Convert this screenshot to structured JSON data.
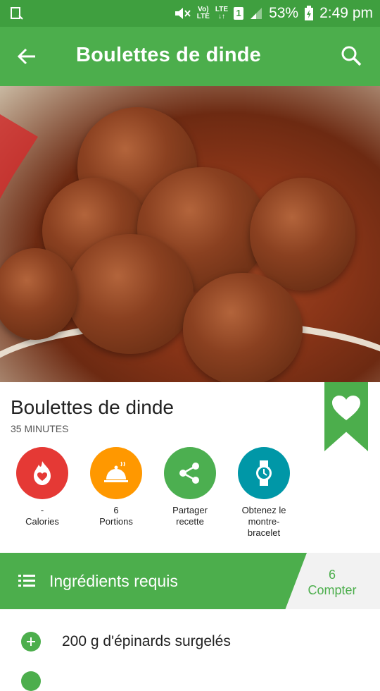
{
  "status_bar": {
    "network_top": "Vo)",
    "network_bottom": "LTE",
    "lte_top": "LTE",
    "lte_bottom": "↓↑",
    "sim": "1",
    "battery": "53%",
    "time": "2:49 pm"
  },
  "app_bar": {
    "title": "Boulettes de dinde",
    "back_icon": "arrow-left-icon",
    "search_icon": "search-icon"
  },
  "recipe": {
    "title": "Boulettes de dinde",
    "time": "35 MINUTES",
    "favorite_icon": "heart-icon"
  },
  "metrics": [
    {
      "value": "-",
      "label": "Calories",
      "color": "#e53935",
      "icon": "flame-heart-icon"
    },
    {
      "value": "6",
      "label": "Portions",
      "color": "#ff9800",
      "icon": "cloche-icon"
    },
    {
      "value": "Partager",
      "label": "recette",
      "color": "#4caf50",
      "icon": "share-icon"
    },
    {
      "value": "Obtenez le",
      "label": "montre-",
      "extra": "bracelet",
      "color": "#0097a7",
      "icon": "watch-icon"
    }
  ],
  "ingredients": {
    "header": "Ingrédients requis",
    "count_value": "6",
    "count_label": "Compter",
    "items": [
      {
        "text": "200 g d'épinards surgelés"
      }
    ]
  },
  "colors": {
    "primary": "#4cae4c",
    "status": "#3f9f3f"
  }
}
